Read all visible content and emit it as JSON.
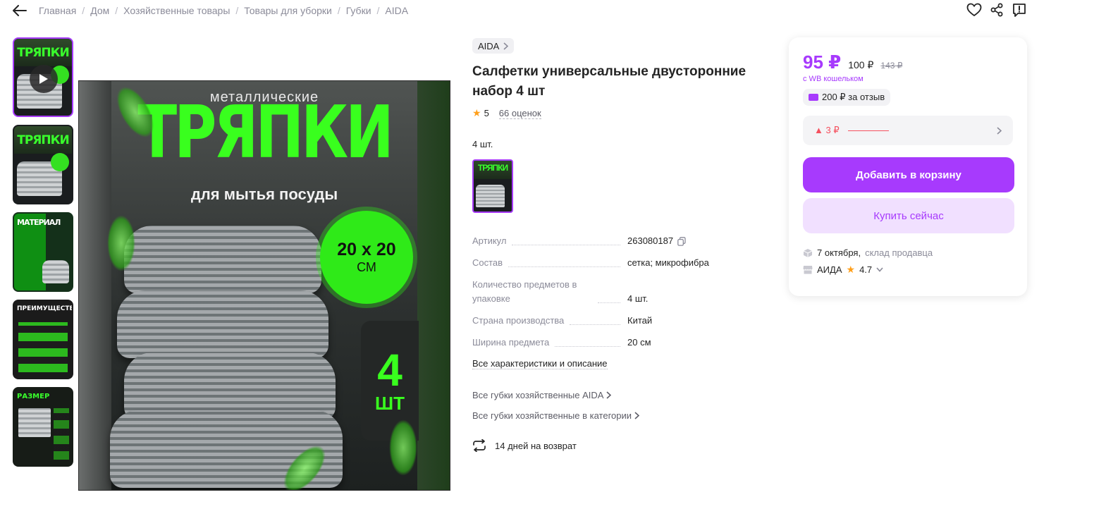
{
  "breadcrumb": [
    "Главная",
    "Дом",
    "Хозяйственные товары",
    "Товары для уборки",
    "Губки",
    "AIDA"
  ],
  "breadcrumb_separator": "/",
  "image": {
    "top_small_text": "металлические",
    "big_text": "ТРЯПКИ",
    "sub_text": "для мытья посуды",
    "size_line1": "20 x 20",
    "size_line2": "СМ",
    "count_number": "4",
    "count_unit": "ШТ",
    "accent_color": "#39ff1e"
  },
  "thumbnails": [
    {
      "label": "ТРЯПКИ",
      "kind": "video",
      "active": true
    },
    {
      "label": "ТРЯПКИ",
      "kind": "image",
      "active": false
    },
    {
      "label": "МАТЕРИАЛ",
      "kind": "image",
      "active": false
    },
    {
      "label": "ПРЕИМУЩЕСТВА",
      "kind": "image",
      "active": false
    },
    {
      "label": "РАЗМЕР",
      "kind": "image",
      "active": false
    }
  ],
  "product": {
    "brand": "AIDA",
    "title": "Салфетки универсальные двусторонние набор 4 шт",
    "rating": "5",
    "reviews": "66 оценок",
    "quantity_label": "4 шт.",
    "variant_label": "ТРЯПКИ"
  },
  "specs": [
    {
      "key": "Артикул",
      "value": "263080187"
    },
    {
      "key": "Состав",
      "value": "сетка; микрофибра"
    },
    {
      "key": "Количество предметов в упаковке",
      "value": "4 шт."
    },
    {
      "key": "Страна производства",
      "value": "Китай"
    },
    {
      "key": "Ширина предмета",
      "value": "20 см"
    }
  ],
  "links": {
    "all_specs": "Все характеристики и описание",
    "all_brand": "Все губки хозяйственные AIDA",
    "all_category": "Все губки хозяйственные в категории"
  },
  "return_policy": "14 дней на возврат",
  "price_card": {
    "price": "95 ₽",
    "price_old": "100 ₽",
    "price_crossed": "143 ₽",
    "wallet_note": "с WB кошельком",
    "review_bonus": "200 ₽ за отзыв",
    "price_change": "▲ 3 ₽",
    "add_to_cart": "Добавить в корзину",
    "buy_now": "Купить сейчас",
    "delivery_date": "7 октября,",
    "delivery_source": "склад продавца",
    "seller_name": "АИДА",
    "seller_rating": "4.7",
    "brand_color": "#a73afd",
    "price_change_color": "#f5515f"
  },
  "icons": {
    "back": "arrow-left-icon",
    "favorite": "heart-icon",
    "share": "share-icon",
    "report": "report-icon",
    "copy": "copy-icon",
    "return": "return-arrows-icon",
    "delivery": "box-icon",
    "seller": "shop-icon"
  }
}
